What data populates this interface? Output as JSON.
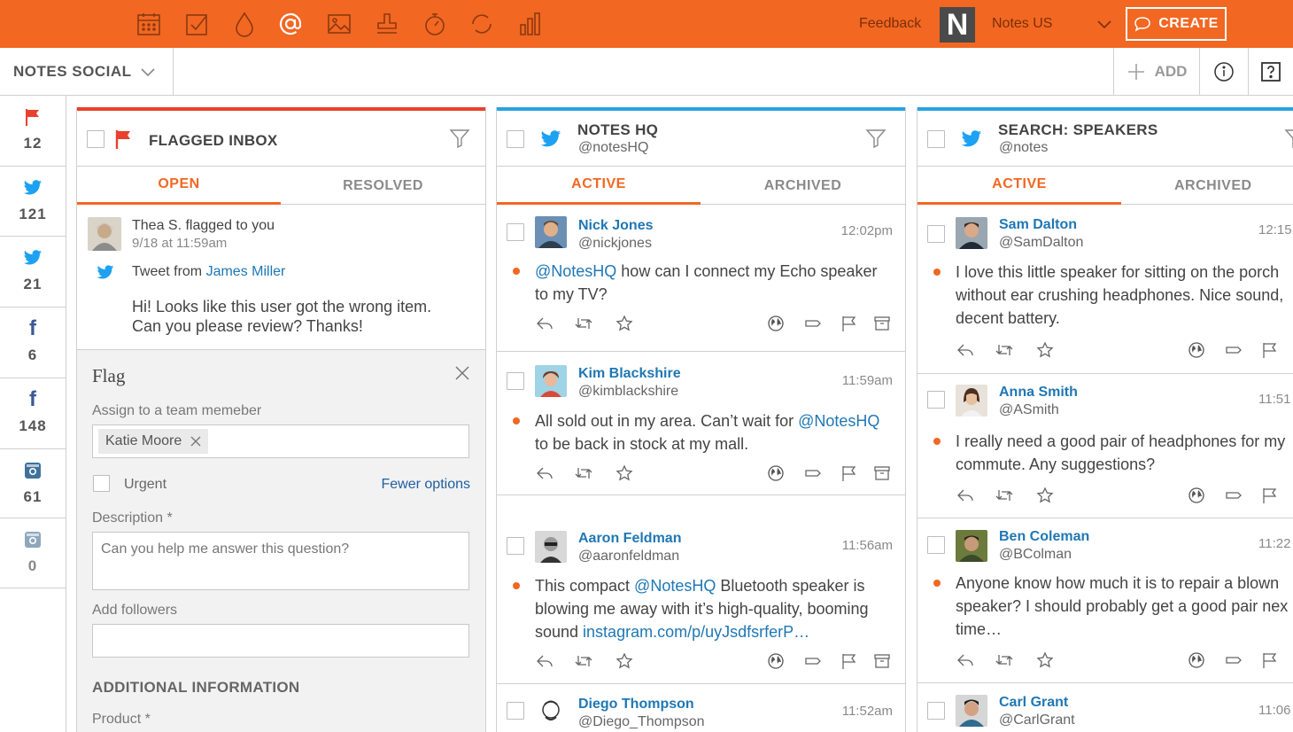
{
  "topbar": {
    "icons": [
      "calendar-icon",
      "checkbox-icon",
      "drop-icon",
      "at-icon",
      "image-icon",
      "stamp-icon",
      "stopwatch-icon",
      "refresh-icon",
      "bar-chart-icon"
    ],
    "feedback": "Feedback",
    "logo": "N",
    "account": "Notes US",
    "create_label": "CREATE",
    "accent": "#f26722"
  },
  "subbar": {
    "workspace": "NOTES SOCIAL",
    "add_label": "ADD"
  },
  "rail": [
    {
      "icon": "flag-icon",
      "count": "12"
    },
    {
      "icon": "twitter-icon",
      "count": "121"
    },
    {
      "icon": "twitter-icon",
      "count": "21"
    },
    {
      "icon": "facebook-icon",
      "count": "6"
    },
    {
      "icon": "facebook-icon",
      "count": "148"
    },
    {
      "icon": "instagram-icon",
      "count": "61"
    },
    {
      "icon": "instagram-icon",
      "count": "0"
    }
  ],
  "flagged": {
    "title": "FLAGGED INBOX",
    "tabs": [
      "OPEN",
      "RESOLVED"
    ],
    "item": {
      "who": "Thea S. flagged to you",
      "when": "9/18 at 11:59am",
      "source_prefix": "Tweet from ",
      "source_user": "James Miller",
      "message_1": "Hi! Looks like this user got the wrong item.",
      "message_2": "Can you please review? Thanks!"
    },
    "form": {
      "title": "Flag",
      "assign_label": "Assign to a team memeber",
      "assignee": "Katie Moore",
      "urgent_label": "Urgent",
      "fewer_options": "Fewer options",
      "description_label": "Description *",
      "description_placeholder": "Can you help me answer this question?",
      "followers_label": "Add followers",
      "additional_info": "ADDITIONAL INFORMATION",
      "product_label": "Product *"
    }
  },
  "notes_hq": {
    "title": "NOTES HQ",
    "handle": "@notesHQ",
    "tabs": [
      "ACTIVE",
      "ARCHIVED"
    ],
    "tweets": [
      {
        "name": "Nick Jones",
        "handle": "@nickjones",
        "time": "12:02pm",
        "parts": [
          "",
          "@NotesHQ",
          " how can I connect my Echo speaker"
        ],
        "line2": "to my TV?"
      },
      {
        "name": "Kim Blackshire",
        "handle": "@kimblackshire",
        "time": "11:59am",
        "parts": [
          "All sold out in my area. Can’t wait for ",
          "@NotesHQ",
          ""
        ],
        "line2": "to be back in stock at my mall."
      },
      {
        "name": "Aaron Feldman",
        "handle": "@aaronfeldman",
        "time": "11:56am",
        "parts": [
          "This compact ",
          "@NotesHQ",
          " Bluetooth speaker is"
        ],
        "line2": "blowing me away with it’s high-quality, booming",
        "line3_prefix": "sound ",
        "line3_link": "instagram.com/p/uyJsdfsrferP…"
      },
      {
        "name": "Diego Thompson",
        "handle": "@Diego_Thompson",
        "time": "11:52am"
      }
    ]
  },
  "search_speakers": {
    "title": "SEARCH: SPEAKERS",
    "handle": "@notes",
    "tabs": [
      "ACTIVE",
      "ARCHIVED"
    ],
    "tweets": [
      {
        "name": "Sam Dalton",
        "handle": "@SamDalton",
        "time": "12:15",
        "lines": [
          "I love this little speaker for sitting on the porch",
          "without ear crushing headphones. Nice sound,",
          "decent battery."
        ]
      },
      {
        "name": "Anna Smith",
        "handle": "@ASmith",
        "time": "11:51",
        "lines": [
          "I really need a good pair of headphones for my",
          "commute. Any suggestions?"
        ]
      },
      {
        "name": "Ben Coleman",
        "handle": "@BColman",
        "time": "11:22",
        "lines": [
          "Anyone know how much it is to repair a blown",
          "speaker? I should probably get a good pair nex",
          "time…"
        ]
      },
      {
        "name": "Carl Grant",
        "handle": "@CarlGrant",
        "time": "11:06"
      }
    ]
  }
}
